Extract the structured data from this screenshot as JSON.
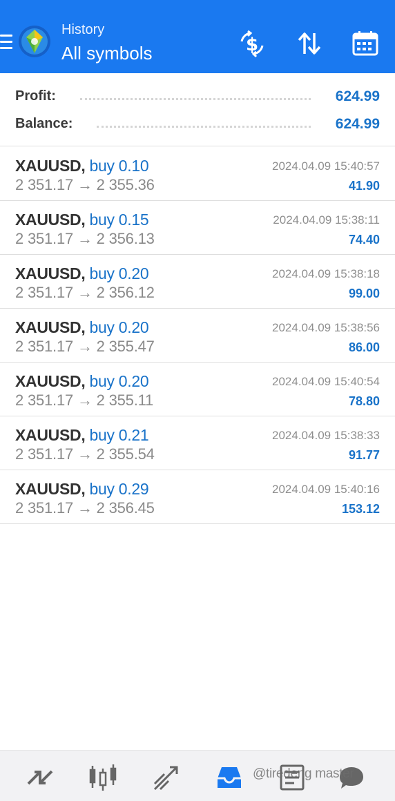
{
  "header": {
    "subtitle": "History",
    "title": "All symbols",
    "icons": [
      "menu-icon",
      "metatrader-logo-icon",
      "currency-exchange-icon",
      "sort-icon",
      "calendar-icon"
    ]
  },
  "summary": {
    "profit_label": "Profit:",
    "profit_value": "624.99",
    "balance_label": "Balance:",
    "balance_value": "624.99"
  },
  "deals": [
    {
      "symbol": "XAUUSD,",
      "side": "buy 0.10",
      "prices": "2 351.17 → 2 355.36",
      "time": "2024.04.09 15:40:57",
      "profit": "41.90"
    },
    {
      "symbol": "XAUUSD,",
      "side": "buy 0.15",
      "prices": "2 351.17 → 2 356.13",
      "time": "2024.04.09 15:38:11",
      "profit": "74.40"
    },
    {
      "symbol": "XAUUSD,",
      "side": "buy 0.20",
      "prices": "2 351.17 → 2 356.12",
      "time": "2024.04.09 15:38:18",
      "profit": "99.00"
    },
    {
      "symbol": "XAUUSD,",
      "side": "buy 0.20",
      "prices": "2 351.17 → 2 355.47",
      "time": "2024.04.09 15:38:56",
      "profit": "86.00"
    },
    {
      "symbol": "XAUUSD,",
      "side": "buy 0.20",
      "prices": "2 351.17 → 2 355.11",
      "time": "2024.04.09 15:40:54",
      "profit": "78.80"
    },
    {
      "symbol": "XAUUSD,",
      "side": "buy 0.21",
      "prices": "2 351.17 → 2 355.54",
      "time": "2024.04.09 15:38:33",
      "profit": "91.77"
    },
    {
      "symbol": "XAUUSD,",
      "side": "buy 0.29",
      "prices": "2 351.17 → 2 356.45",
      "time": "2024.04.09 15:40:16",
      "profit": "153.12"
    }
  ],
  "bottom_nav": {
    "items": [
      "quotes-icon",
      "chart-icon",
      "trade-icon",
      "history-icon",
      "news-icon",
      "chat-icon"
    ],
    "active": "history-icon"
  },
  "watermark": "@tiredeng master",
  "colors": {
    "brand": "#1a79f0",
    "accent_text": "#1a73c9",
    "muted_text": "#8a8a8a"
  }
}
